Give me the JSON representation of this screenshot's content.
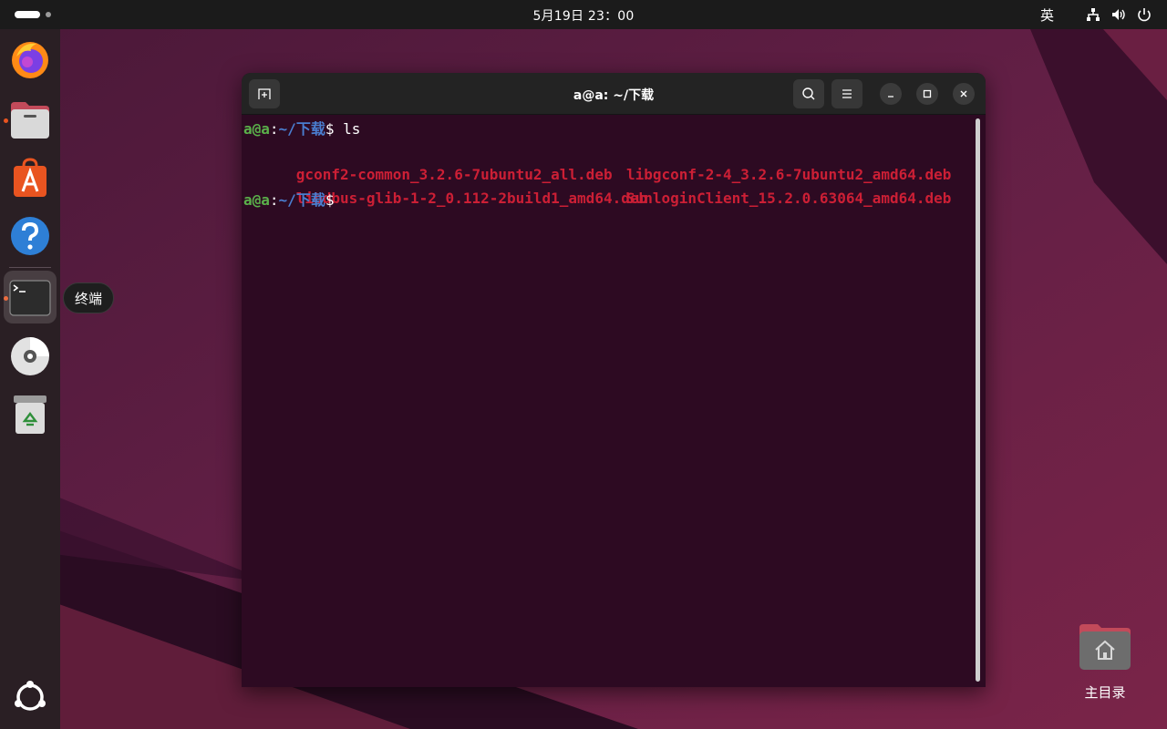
{
  "topbar": {
    "clock": "5月19日  23：00",
    "ime": "英",
    "tray_icons": [
      "network-icon",
      "volume-icon",
      "power-icon"
    ]
  },
  "dock": {
    "items": [
      {
        "name": "firefox",
        "icon": "firefox-icon",
        "running": false
      },
      {
        "name": "files",
        "icon": "files-icon",
        "running": true
      },
      {
        "name": "app-center",
        "icon": "app-center-icon",
        "running": false
      },
      {
        "name": "help",
        "icon": "help-icon",
        "running": false
      },
      {
        "name": "terminal",
        "icon": "terminal-icon",
        "running": true,
        "active": true
      },
      {
        "name": "disc",
        "icon": "disc-icon",
        "running": false
      },
      {
        "name": "trash",
        "icon": "trash-icon",
        "running": false
      },
      {
        "name": "show-apps",
        "icon": "ubuntu-logo-icon",
        "running": false
      }
    ],
    "tooltip": "终端"
  },
  "terminal": {
    "title": "a@a: ~/下载",
    "lines": [
      {
        "user": "a@a",
        "sep": ":",
        "path": "~/下载",
        "prompt": "$ ",
        "command": "ls"
      },
      {
        "files": [
          "gconf2-common_3.2.6-7ubuntu2_all.deb",
          "libgconf-2-4_3.2.6-7ubuntu2_amd64.deb"
        ]
      },
      {
        "files": [
          "libdbus-glib-1-2_0.112-2build1_amd64.deb",
          "SunloginClient_15.2.0.63064_amd64.deb"
        ]
      },
      {
        "user": "a@a",
        "sep": ":",
        "path": "~/下载",
        "prompt": "$",
        "command": ""
      }
    ]
  },
  "desktop": {
    "home_label": "主目录"
  },
  "colors": {
    "terminal_bg": "#2d0a22",
    "prompt_user": "#5ab04a",
    "prompt_path": "#4a7ed0",
    "deb_file": "#cc1f35",
    "accent": "#e95420"
  }
}
